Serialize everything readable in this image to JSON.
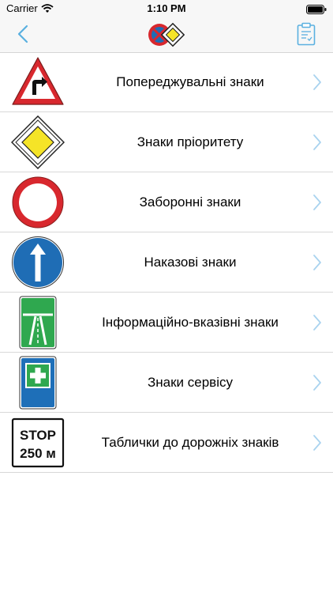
{
  "status": {
    "carrier": "Carrier",
    "time": "1:10 PM"
  },
  "nav": {
    "back_icon": "chevron-left-icon",
    "logo_icon": "road-signs-logo",
    "clipboard_icon": "clipboard-icon"
  },
  "categories": [
    {
      "label": "Попереджувальні знаки",
      "icon": "warning-sign-icon"
    },
    {
      "label": "Знаки пріоритету",
      "icon": "priority-road-sign-icon"
    },
    {
      "label": "Заборонні знаки",
      "icon": "prohibition-sign-icon"
    },
    {
      "label": "Наказові знаки",
      "icon": "mandatory-sign-icon"
    },
    {
      "label": "Інформаційно-вказівні знаки",
      "icon": "motorway-sign-icon"
    },
    {
      "label": "Знаки сервісу",
      "icon": "first-aid-sign-icon"
    },
    {
      "label": "Таблички до дорожніх знаків",
      "icon": "plate-sign-icon"
    }
  ],
  "plate_sign": {
    "line1": "STOP",
    "line2": "250 м"
  },
  "colors": {
    "accent": "#5ab0e0",
    "warning_red": "#d8282e",
    "priority_yellow": "#f5e427",
    "mandatory_blue": "#1f6db5",
    "info_green": "#2fa84f",
    "service_blue": "#1e6fb8"
  }
}
